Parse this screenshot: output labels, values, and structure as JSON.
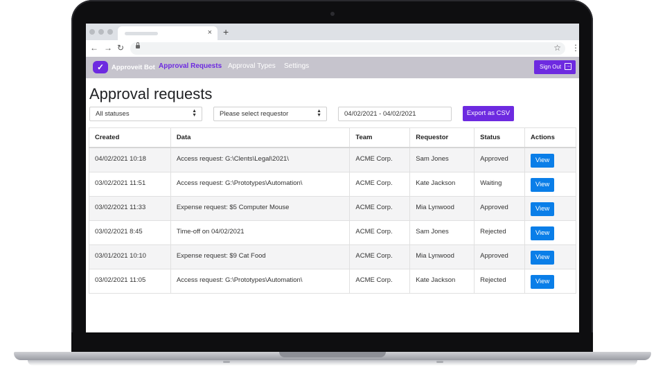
{
  "browser": {
    "new_tab_label": "+",
    "tab_close": "×",
    "back": "←",
    "forward": "→",
    "reload": "↻",
    "star": "☆",
    "menu": "⋮"
  },
  "app": {
    "brand": "Approveit Bot",
    "nav": [
      "Approval Requests",
      "Approval Types",
      "Settings"
    ],
    "active_nav": "Approval Requests",
    "sign_out": "Sign Out",
    "accent_color": "#6d2ae0",
    "button_color": "#0a7ee8"
  },
  "page": {
    "title": "Approval requests",
    "filters": {
      "status": "All statuses",
      "requestor": "Please select requestor",
      "date_range": "04/02/2021 - 04/02/2021"
    },
    "export_label": "Export as CSV"
  },
  "table": {
    "headers": [
      "Created",
      "Data",
      "Team",
      "Requestor",
      "Status",
      "Actions"
    ],
    "rows": [
      {
        "created": "04/02/2021 10:18",
        "data": "Access request: G:\\Clents\\Legal\\2021\\",
        "team": "ACME Corp.",
        "requestor": "Sam Jones",
        "status": "Approved",
        "action": "View"
      },
      {
        "created": "03/02/2021 11:51",
        "data": "Access request: G:\\Prototypes\\Automation\\",
        "team": "ACME Corp.",
        "requestor": "Kate Jackson",
        "status": "Waiting",
        "action": "View"
      },
      {
        "created": "03/02/2021 11:33",
        "data": "Expense request: $5 Computer Mouse",
        "team": "ACME Corp.",
        "requestor": "Mia Lynwood",
        "status": "Approved",
        "action": "View"
      },
      {
        "created": "03/02/2021 8:45",
        "data": "Time-off on 04/02/2021",
        "team": "ACME Corp.",
        "requestor": "Sam Jones",
        "status": "Rejected",
        "action": "View"
      },
      {
        "created": "03/01/2021 10:10",
        "data": "Expense request: $9 Cat Food",
        "team": "ACME Corp.",
        "requestor": "Mia Lynwood",
        "status": "Approved",
        "action": "View"
      },
      {
        "created": "03/02/2021 11:05",
        "data": "Access request: G:\\Prototypes\\Automation\\",
        "team": "ACME Corp.",
        "requestor": "Kate Jackson",
        "status": "Rejected",
        "action": "View"
      }
    ]
  }
}
